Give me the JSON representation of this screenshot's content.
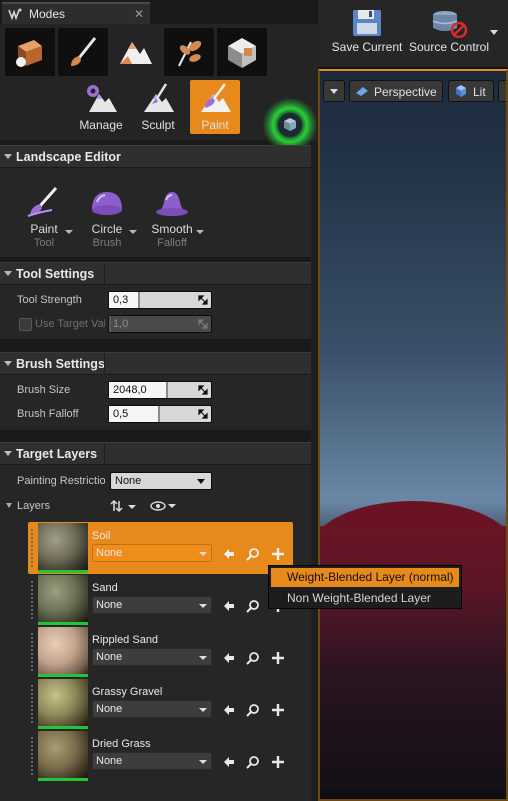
{
  "window": {
    "tab_title": "Modes"
  },
  "modes": {
    "tools": [
      {
        "label": "Manage",
        "active": false
      },
      {
        "label": "Sculpt",
        "active": false
      },
      {
        "label": "Paint",
        "active": true
      }
    ]
  },
  "landscape_editor": {
    "title": "Landscape Editor",
    "tools": [
      {
        "main": "Paint",
        "sub": "Tool"
      },
      {
        "main": "Circle",
        "sub": "Brush"
      },
      {
        "main": "Smooth",
        "sub": "Falloff"
      }
    ]
  },
  "tool_settings": {
    "title": "Tool Settings",
    "tool_strength": {
      "label": "Tool Strength",
      "value": "0,3",
      "fraction": 0.3
    },
    "use_target_value": {
      "label": "Use Target Value",
      "value": "1,0",
      "fraction": 0.0
    }
  },
  "brush_settings": {
    "title": "Brush Settings",
    "brush_size": {
      "label": "Brush Size",
      "value": "2048,0",
      "fraction": 0.58
    },
    "brush_falloff": {
      "label": "Brush Falloff",
      "value": "0,5",
      "fraction": 0.5
    }
  },
  "target_layers": {
    "title": "Target Layers",
    "painting_restriction": {
      "label": "Painting Restriction",
      "value": "None"
    },
    "layers_label": "Layers",
    "layers": [
      {
        "name": "Soil",
        "value": "None",
        "active": true
      },
      {
        "name": "Sand",
        "value": "None",
        "active": false
      },
      {
        "name": "Rippled Sand",
        "value": "None",
        "active": false
      },
      {
        "name": "Grassy Gravel",
        "value": "None",
        "active": false
      },
      {
        "name": "Dried Grass",
        "value": "None",
        "active": false
      }
    ]
  },
  "layer_popup": {
    "items": [
      {
        "label": "Weight-Blended Layer (normal)",
        "highlighted": true
      },
      {
        "label": "Non Weight-Blended Layer",
        "highlighted": false
      }
    ]
  },
  "viewport_toolbar": {
    "save_current": "Save Current",
    "source_control": "Source Control"
  },
  "viewport": {
    "perspective": "Perspective",
    "lit": "Lit"
  },
  "colors": {
    "accent": "#e8891b",
    "layer_highlight": "#22c53a"
  }
}
